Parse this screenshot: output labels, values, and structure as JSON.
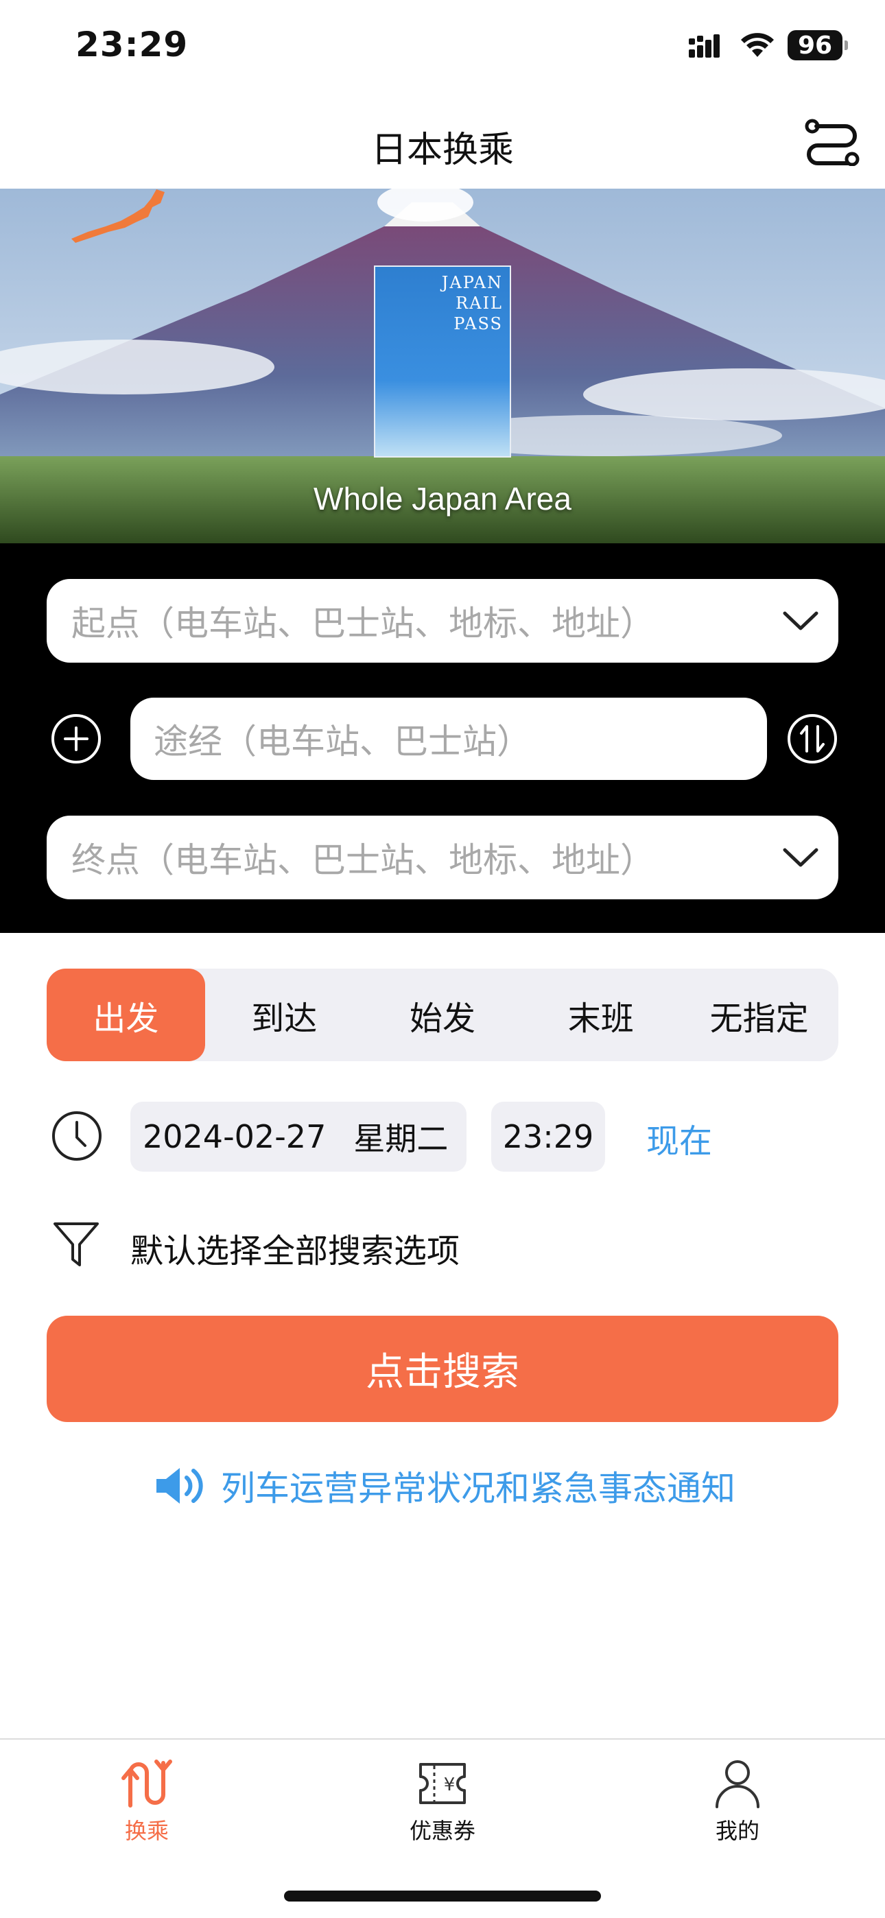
{
  "status_bar": {
    "time": "23:29",
    "battery": "96"
  },
  "nav": {
    "title": "日本换乘",
    "route_icon": "route-settings-icon"
  },
  "hero": {
    "pass_text": "JAPAN\nRAIL\nPASS",
    "caption": "Whole Japan Area"
  },
  "route": {
    "from_placeholder": "起点（电车站、巴士站、地标、地址）",
    "via_placeholder": "途经（电车站、巴士站）",
    "to_placeholder": "终点（电车站、巴士站、地标、地址）"
  },
  "tabs": [
    {
      "label": "出发",
      "active": true
    },
    {
      "label": "到达",
      "active": false
    },
    {
      "label": "始发",
      "active": false
    },
    {
      "label": "末班",
      "active": false
    },
    {
      "label": "无指定",
      "active": false
    }
  ],
  "datetime": {
    "date": "2024-02-27",
    "weekday": "星期二",
    "time": "23:29",
    "now_label": "现在"
  },
  "filter": {
    "label": "默认选择全部搜索选项"
  },
  "search": {
    "button_label": "点击搜索"
  },
  "notice": {
    "text": "列车运营异常状况和紧急事态通知"
  },
  "tabbar": [
    {
      "label": "换乘",
      "icon": "transfer-icon",
      "active": true
    },
    {
      "label": "优惠券",
      "icon": "coupon-icon",
      "active": false
    },
    {
      "label": "我的",
      "icon": "profile-icon",
      "active": false
    }
  ],
  "colors": {
    "accent": "#f56e48",
    "link": "#3d9be9",
    "panel": "#000000",
    "chip": "#efeff4"
  }
}
